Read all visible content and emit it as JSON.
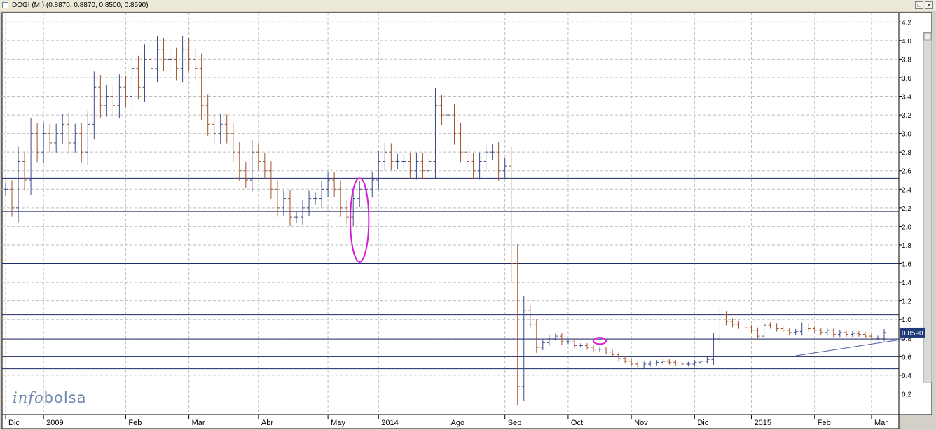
{
  "window": {
    "title": "DOGI (M.) (0.8870, 0.8870, 0.8500, 0.8590)"
  },
  "watermark": {
    "part1": "info",
    "part2": "bolsa"
  },
  "colors": {
    "up": "#3b4a86",
    "down": "#a1502b",
    "hline": "#1e2a6a",
    "ellipse": "#d51fd6",
    "grid": "#bdbdbd",
    "price_badge_bg": "#1f3a78",
    "trendline": "#4a5aa0"
  },
  "chart_data": {
    "type": "ohlc",
    "title": "DOGI (M.) (0.8870, 0.8870, 0.8500, 0.8590)",
    "ylim": [
      0,
      4.3
    ],
    "y_ticks": [
      "4.2",
      "4.0",
      "3.8",
      "3.6",
      "3.4",
      "3.2",
      "3.0",
      "2.8",
      "2.6",
      "2.4",
      "2.2",
      "2.0",
      "1.8",
      "1.6",
      "1.4",
      "1.2",
      "1.0",
      "0.8",
      "0.6",
      "0.4",
      "0.2"
    ],
    "x_labels": [
      "Dic",
      "2009",
      "Feb",
      "Mar",
      "Abr",
      "May",
      "2014",
      "Ago",
      "Sep",
      "Oct",
      "Nov",
      "Dic",
      "2015",
      "Feb",
      "Mar"
    ],
    "last_price": "0.8590",
    "grid": true,
    "horizontal_lines": [
      2.52,
      2.16,
      1.6,
      1.05,
      0.79,
      0.6,
      0.47
    ],
    "annotations": [
      {
        "type": "ellipse",
        "x_index": 56,
        "y_center": 2.07,
        "y_radius": 0.45
      },
      {
        "type": "ellipse",
        "x_index": 94,
        "y_center": 0.77,
        "y_radius": 0.035
      },
      {
        "type": "trendline",
        "from_index": 125,
        "from_y": 0.61,
        "to_index": 140,
        "to_y": 0.79
      }
    ],
    "series": [
      {
        "close": [
          2.4,
          2.2,
          2.7,
          2.5,
          3.0,
          2.8,
          3.0,
          2.9,
          3.0,
          3.1,
          2.9,
          3.0,
          2.8,
          3.1,
          3.5,
          3.3,
          3.4,
          3.3,
          3.5,
          3.4,
          3.7,
          3.5,
          3.8,
          3.7,
          3.9,
          3.8,
          3.8,
          3.7,
          3.9,
          3.8,
          3.7,
          3.3,
          3.1,
          3.0,
          3.1,
          3.0,
          2.8,
          2.6,
          2.5,
          2.8,
          2.7,
          2.6,
          2.4,
          2.2,
          2.3,
          2.1,
          2.1,
          2.2,
          2.3,
          2.3,
          2.4,
          2.5,
          2.4,
          2.2,
          2.1,
          2.3,
          2.4,
          2.4,
          2.5,
          2.7,
          2.8,
          2.7,
          2.7,
          2.7,
          2.6,
          2.7,
          2.6,
          2.7,
          3.3,
          3.2,
          3.2,
          3.0,
          2.8,
          2.7,
          2.6,
          2.7,
          2.8,
          2.8,
          2.6,
          2.65,
          1.6,
          0.28,
          1.1,
          0.95,
          0.7,
          0.75,
          0.8,
          0.82,
          0.76,
          0.76,
          0.72,
          0.72,
          0.7,
          0.68,
          0.68,
          0.65,
          0.62,
          0.58,
          0.55,
          0.52,
          0.5,
          0.52,
          0.53,
          0.54,
          0.55,
          0.54,
          0.53,
          0.52,
          0.52,
          0.54,
          0.55,
          0.57,
          0.8,
          1.05,
          0.98,
          0.95,
          0.93,
          0.91,
          0.88,
          0.82,
          0.94,
          0.93,
          0.9,
          0.88,
          0.86,
          0.87,
          0.93,
          0.9,
          0.88,
          0.86,
          0.88,
          0.84,
          0.86,
          0.84,
          0.85,
          0.84,
          0.82,
          0.8,
          0.8,
          0.86
        ]
      }
    ]
  }
}
